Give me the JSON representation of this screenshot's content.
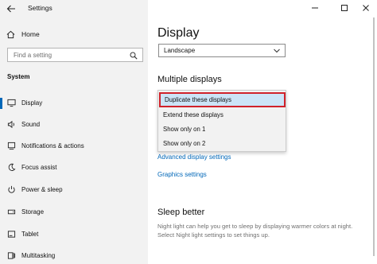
{
  "window": {
    "title": "Settings",
    "controls": [
      "minimize-icon",
      "maximize-icon",
      "close-icon"
    ]
  },
  "sidebar": {
    "home_label": "Home",
    "search_placeholder": "Find a setting",
    "section_label": "System",
    "items": [
      {
        "label": "Display",
        "icon": "monitor-icon",
        "selected": true
      },
      {
        "label": "Sound",
        "icon": "speaker-icon",
        "selected": false
      },
      {
        "label": "Notifications & actions",
        "icon": "notification-icon",
        "selected": false
      },
      {
        "label": "Focus assist",
        "icon": "moon-icon",
        "selected": false
      },
      {
        "label": "Power & sleep",
        "icon": "power-icon",
        "selected": false
      },
      {
        "label": "Storage",
        "icon": "storage-icon",
        "selected": false
      },
      {
        "label": "Tablet",
        "icon": "tablet-icon",
        "selected": false
      },
      {
        "label": "Multitasking",
        "icon": "multitasking-icon",
        "selected": false
      }
    ]
  },
  "main": {
    "title": "Display",
    "orientation_value": "Landscape",
    "multiple_displays_heading": "Multiple displays",
    "dropdown_options": [
      {
        "label": "Duplicate these displays",
        "selected": true
      },
      {
        "label": "Extend these displays",
        "selected": false
      },
      {
        "label": "Show only on 1",
        "selected": false
      },
      {
        "label": "Show only on 2",
        "selected": false
      }
    ],
    "advanced_link": "Advanced display settings",
    "graphics_link": "Graphics settings",
    "sleep_heading": "Sleep better",
    "sleep_text": "Night light can help you get to sleep by displaying warmer colors at night. Select Night light settings to set things up."
  },
  "colors": {
    "accent": "#0067b8",
    "highlight_border": "#d0222b",
    "selection_fill": "#cce4f7",
    "sidebar_bg": "#f2f2f2"
  }
}
